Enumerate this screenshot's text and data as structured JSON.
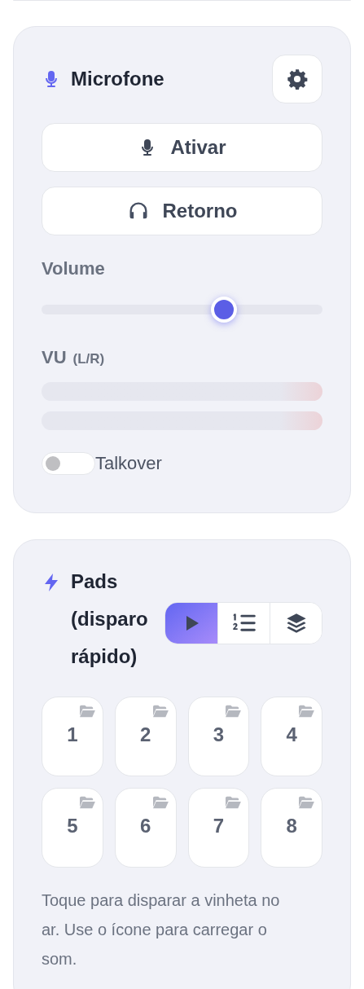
{
  "microphone": {
    "title": "Microfone",
    "buttons": [
      {
        "kind": "mic",
        "label": "Ativar"
      },
      {
        "kind": "headphones",
        "label": "Retorno"
      }
    ],
    "volume": {
      "label": "Volume",
      "level": 0.65
    },
    "vu": {
      "label": "VU",
      "sublabel": "(L/R)",
      "meters": [
        {
          "level": 0
        },
        {
          "level": 0
        }
      ]
    },
    "talkover": {
      "label": "Talkover",
      "on": false
    }
  },
  "pads": {
    "title": "Pads (disparo rápido)",
    "modes": [
      {
        "kind": "play",
        "selected": true
      },
      {
        "kind": "list",
        "selected": false
      },
      {
        "kind": "layers",
        "selected": false
      }
    ],
    "items": [
      {
        "label": "1"
      },
      {
        "label": "2"
      },
      {
        "label": "3"
      },
      {
        "label": "4"
      },
      {
        "label": "5"
      },
      {
        "label": "6"
      },
      {
        "label": "7"
      },
      {
        "label": "8"
      }
    ],
    "hint": "Toque para disparar a vinheta no ar. Use o ícone para carregar o som."
  }
}
